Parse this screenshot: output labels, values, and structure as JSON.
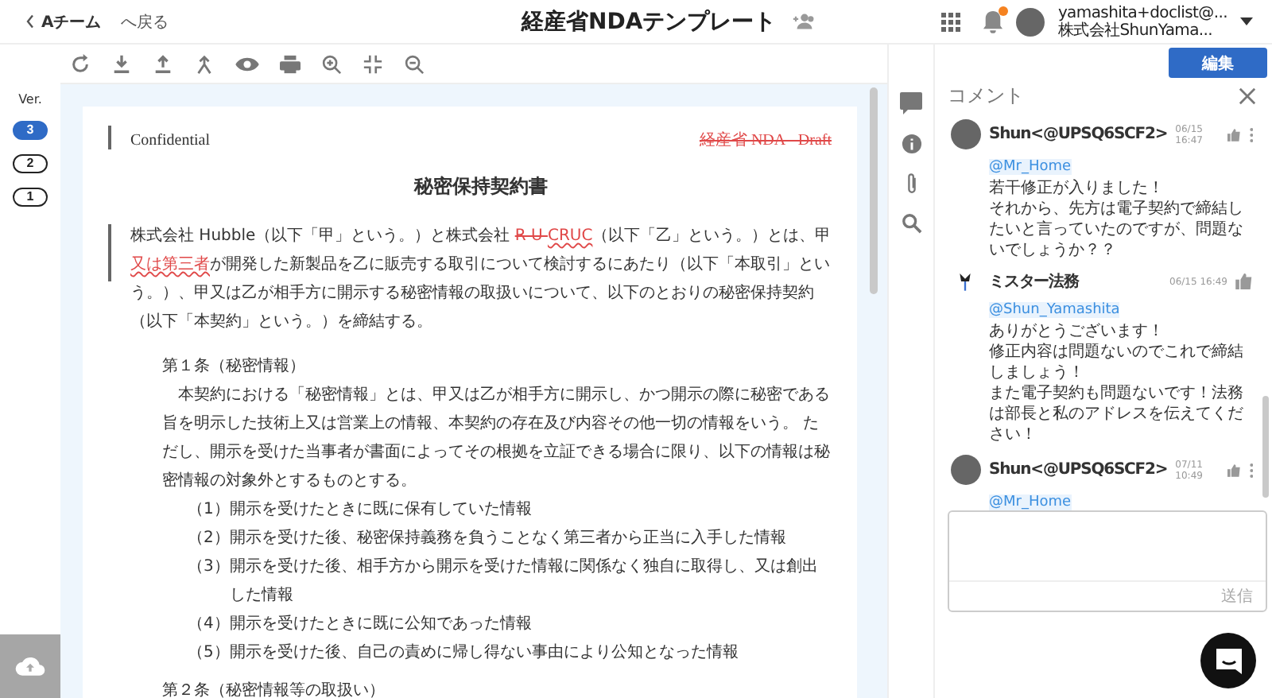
{
  "header": {
    "back_team": "Aチーム",
    "back_label": "へ戻る",
    "title": "経産省NDAテンプレート",
    "notification": true,
    "user_email": "yamashita+doclist@...",
    "user_company": "株式会社ShunYama..."
  },
  "edit_button": "編集",
  "versions": {
    "label": "Ver.",
    "items": [
      {
        "label": "3",
        "selected": true
      },
      {
        "label": "2",
        "selected": false
      },
      {
        "label": "1",
        "selected": false
      }
    ]
  },
  "document": {
    "header_left": "Confidential",
    "header_right": {
      "text": "経産省 NDA - Draft",
      "kind": "deleted"
    },
    "title": "秘密保持契約書",
    "intro": {
      "changed": true,
      "segments": [
        {
          "kind": "plain",
          "text": "株式会社 Hubble（以下「甲」という。）と株式会社 "
        },
        {
          "kind": "deleted",
          "text": "R U "
        },
        {
          "kind": "inserted",
          "text": "CRUC"
        },
        {
          "kind": "plain",
          "text": "（以下「乙」という。）とは、甲"
        },
        {
          "kind": "inserted",
          "text": "又は第三者"
        },
        {
          "kind": "plain",
          "text": "が開発した新製品を乙に販売する取引について検討するにあたり（以下「本取引」という。）、甲又は乙が相手方に開示する秘密情報の取扱いについて、以下のとおりの秘密保持契約（以下「本契約」という。）を締結する。"
        }
      ]
    },
    "articles": [
      {
        "heading": "第１条（秘密情報）",
        "body": "本契約における「秘密情報」とは、甲又は乙が相手方に開示し、かつ開示の際に秘密である旨を明示した技術上又は営業上の情報、本契約の存在及び内容その他一切の情報をいう。 ただし、開示を受けた当事者が書面によってその根拠を立証できる場合に限り、以下の情報は秘密情報の対象外とするものとする。",
        "items": [
          {
            "number": "（1）",
            "text": "開示を受けたときに既に保有していた情報"
          },
          {
            "number": "（2）",
            "text": "開示を受けた後、秘密保持義務を負うことなく第三者から正当に入手した情報"
          },
          {
            "number": "（3）",
            "text": "開示を受けた後、相手方から開示を受けた情報に関係なく独自に取得し、又は創出した情報"
          },
          {
            "number": "（4）",
            "text": "開示を受けたときに既に公知であった情報"
          },
          {
            "number": "（5）",
            "text": "開示を受けた後、自己の責めに帰し得ない事由により公知となった情報"
          }
        ]
      },
      {
        "heading": "第２条（秘密情報等の取扱い）"
      }
    ]
  },
  "comments": {
    "title": "コメント",
    "items": [
      {
        "author": "Shun<@UPSQ6SCF2>",
        "kind": "photo",
        "time": "06/15 16:47",
        "menu": true,
        "mention": "@Mr_Home",
        "body": [
          "若干修正が入りました！",
          "それから、先方は電子契約で締結したいと言っていたのですが、問題ないでしょうか？？"
        ]
      },
      {
        "author": "ミスター法務",
        "kind": "logo",
        "time": "06/15 16:49",
        "menu": false,
        "mention": "@Shun_Yamashita",
        "body": [
          "ありがとうございます！",
          "修正内容は問題ないのでこれで締結しましょう！",
          "また電子契約も問題ないです！法務は部長と私のアドレスを伝えてください！"
        ]
      },
      {
        "author": "Shun<@UPSQ6SCF2>",
        "kind": "photo",
        "time": "07/11 10:49",
        "menu": true,
        "mention": "@Mr_Home"
      }
    ],
    "send_button": "送信",
    "send_disabled": true
  }
}
